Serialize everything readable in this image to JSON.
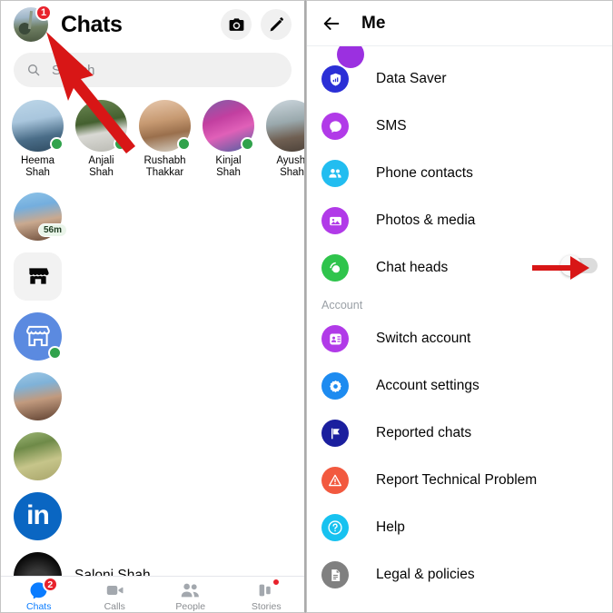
{
  "left_panel": {
    "header": {
      "title": "Chats",
      "profile_badge": "1",
      "profile_icon": "profile-avatar",
      "camera_icon": "camera-icon",
      "compose_icon": "pencil-compose-icon"
    },
    "search": {
      "placeholder": "Search",
      "value": "Search",
      "icon": "search-icon"
    },
    "stories": [
      {
        "name": "Heema Shah",
        "online": true
      },
      {
        "name": "Anjali Shah",
        "online": true
      },
      {
        "name": "Rushabh Thakkar",
        "online": true
      },
      {
        "name": "Kinjal Shah",
        "online": true
      },
      {
        "name": "Ayushi Shah",
        "online": true
      }
    ],
    "chats": [
      {
        "name": "",
        "time_badge": "56m",
        "avatar_type": "photo-couple",
        "online": false
      },
      {
        "name": "",
        "time_badge": "",
        "avatar_type": "marketplace-square-icon",
        "online": false
      },
      {
        "name": "",
        "time_badge": "",
        "avatar_type": "marketplace-blue-icon",
        "online": true
      },
      {
        "name": "",
        "time_badge": "",
        "avatar_type": "photo-couple-2",
        "online": false
      },
      {
        "name": "",
        "time_badge": "",
        "avatar_type": "photo-field",
        "online": false
      },
      {
        "name": "",
        "time_badge": "",
        "avatar_type": "linkedin-icon",
        "online": false
      },
      {
        "name": "Saloni Shah",
        "time_badge": "",
        "avatar_type": "photo-dark",
        "online": false
      }
    ],
    "bottom_nav": [
      {
        "label": "Chats",
        "icon": "chat-bubble-icon",
        "active": true,
        "badge": "2"
      },
      {
        "label": "Calls",
        "icon": "video-camera-icon",
        "active": false,
        "badge": ""
      },
      {
        "label": "People",
        "icon": "people-icon",
        "active": false,
        "badge": ""
      },
      {
        "label": "Stories",
        "icon": "stories-icon",
        "active": false,
        "badge": "dot"
      }
    ]
  },
  "right_panel": {
    "header": {
      "title": "Me",
      "back_icon": "back-arrow-icon"
    },
    "items": [
      {
        "label": "Data Saver",
        "icon": "shield-bars-icon",
        "color": "#2b2fd6",
        "type": "row"
      },
      {
        "label": "SMS",
        "icon": "chat-bubble-icon",
        "color": "#b13ae8",
        "type": "row"
      },
      {
        "label": "Phone contacts",
        "icon": "people-icon",
        "color": "#22bdf0",
        "type": "row"
      },
      {
        "label": "Photos & media",
        "icon": "photo-icon",
        "color": "#b13ae8",
        "type": "row"
      },
      {
        "label": "Chat heads",
        "icon": "chat-heads-icon",
        "color": "#2fc44c",
        "type": "toggle",
        "toggle_on": false
      },
      {
        "label": "Account",
        "type": "section"
      },
      {
        "label": "Switch account",
        "icon": "switch-account-icon",
        "color": "#b13ae8",
        "type": "row"
      },
      {
        "label": "Account settings",
        "icon": "gear-icon",
        "color": "#1d8bf0",
        "type": "row"
      },
      {
        "label": "Reported chats",
        "icon": "flag-icon",
        "color": "#1b1f9e",
        "type": "row"
      },
      {
        "label": "Report Technical Problem",
        "icon": "warning-icon",
        "color": "#f2593f",
        "type": "row"
      },
      {
        "label": "Help",
        "icon": "question-icon",
        "color": "#17c2f0",
        "type": "row"
      },
      {
        "label": "Legal & policies",
        "icon": "document-icon",
        "color": "#808080",
        "type": "row"
      }
    ]
  },
  "annotations": {
    "arrow_color": "#d81616",
    "arrow_left_target": "profile-avatar",
    "arrow_right_target": "chat-heads-toggle"
  }
}
